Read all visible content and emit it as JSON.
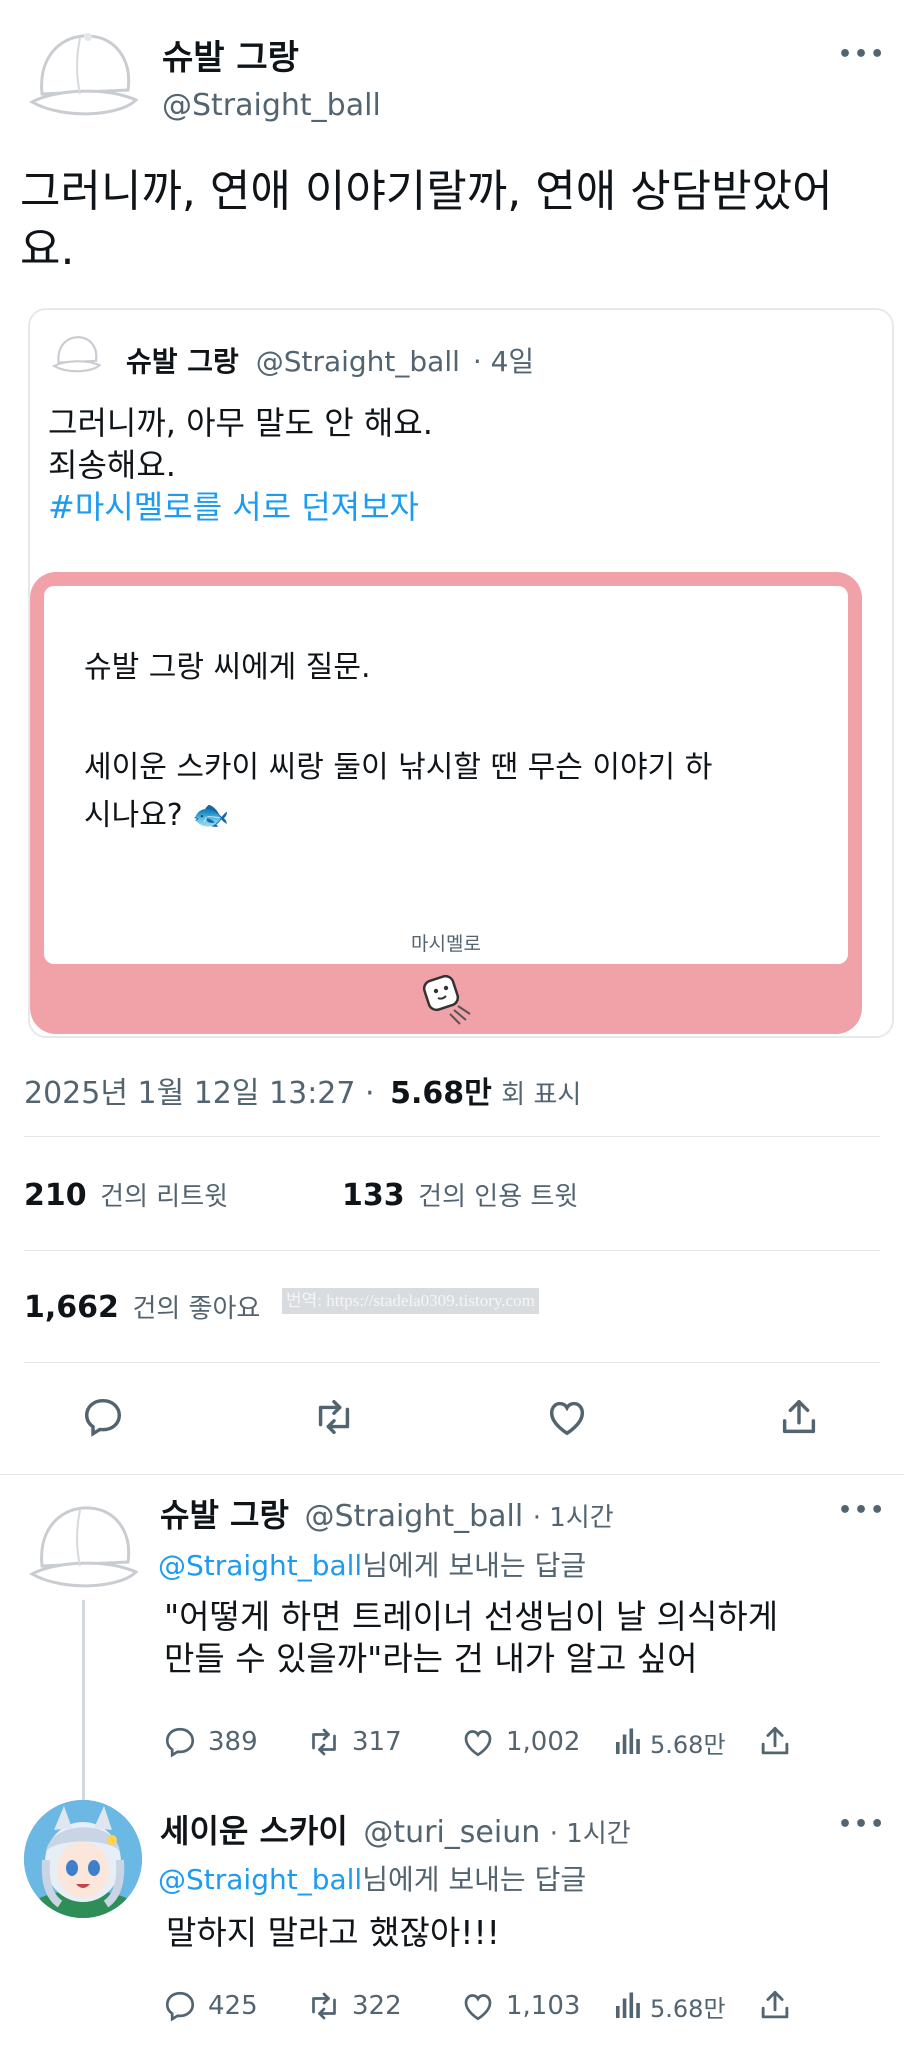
{
  "tweet": {
    "author_name": "슈발 그랑",
    "author_handle": "@Straight_ball",
    "text": "그러니까, 연애 이야기랄까, 연애 상담받았어요.",
    "more_icon": "more-icon",
    "quote": {
      "author_name": "슈발 그랑",
      "author_handle": "@Straight_ball",
      "time": "· 4일",
      "line1": "그러니까, 아무 말도 안 해요.",
      "line2": "죄송해요.",
      "hashtag": "#마시멜로를 서로 던져보자",
      "card": {
        "question_line1": "슈발 그랑 씨에게 질문.",
        "question_line2": "세이운 스카이 씨랑 둘이 낚시할 땐 무슨 이야기 하",
        "question_line3": "시나요? 🐟",
        "brand": "마시멜로",
        "border_color": "#f1a1a8"
      }
    },
    "timestamp": "2025년 1월 12일  13:27 ·",
    "views_count": "5.68만",
    "views_label": "회 표시",
    "retweets_count": "210",
    "retweets_label": "건의 리트윗",
    "quotes_count": "133",
    "quotes_label": "건의 인용 트윗",
    "likes_count": "1,662",
    "likes_label": "건의 좋아요",
    "watermark": "번역: https://stadela0309.tistory.com"
  },
  "actions": [
    "reply-icon",
    "retweet-icon",
    "like-icon",
    "share-icon"
  ],
  "replies": [
    {
      "author_name": "슈발 그랑",
      "author_handle": "@Straight_ball",
      "time": "· 1시간",
      "reply_to_handle": "@Straight_ball",
      "reply_to_suffix": "님에게 보내는 답글",
      "text_line1": "\"어떻게 하면 트레이너 선생님이 날 의식하게",
      "text_line2": "만들 수 있을까\"라는 건 내가 알고 싶어",
      "replies": "389",
      "retweets": "317",
      "likes": "1,002",
      "views": "5.68만"
    },
    {
      "author_name": "세이운 스카이",
      "author_handle": "@turi_seiun",
      "time": "· 1시간",
      "reply_to_handle": "@Straight_ball",
      "reply_to_suffix": "님에게 보내는 답글",
      "text_line1": "말하지 말라고 했잖아!!!",
      "replies": "425",
      "retweets": "322",
      "likes": "1,103",
      "views": "5.68만"
    }
  ],
  "colors": {
    "accent": "#1d9bf0",
    "text": "#0f1419",
    "secondary": "#536471",
    "card_pink": "#f1a1a8"
  }
}
